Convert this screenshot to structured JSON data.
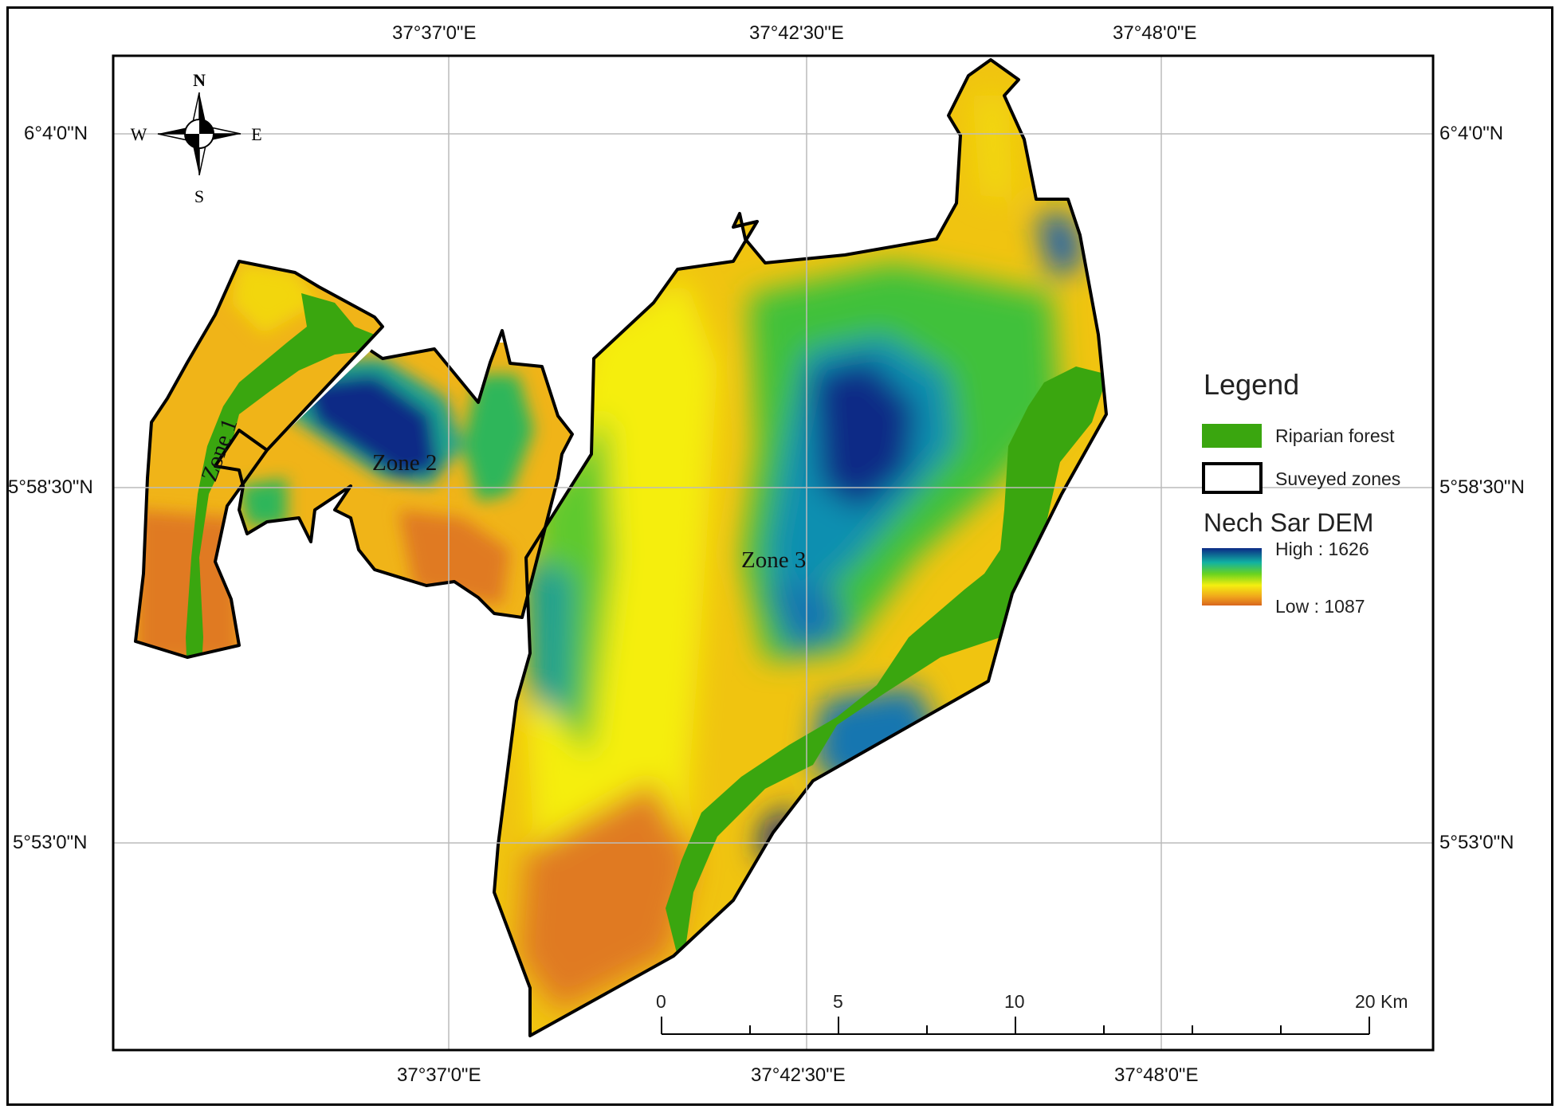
{
  "top_ticks": [
    "37°37'0\"E",
    "37°42'30\"E",
    "37°48'0\"E"
  ],
  "bottom_ticks": [
    "37°37'0\"E",
    "37°42'30\"E",
    "37°48'0\"E"
  ],
  "left_ticks": [
    "6°4'0\"N",
    "5°58'30\"N",
    "5°53'0\"N"
  ],
  "right_ticks": [
    "6°4'0\"N",
    "5°58'30\"N",
    "5°53'0\"N"
  ],
  "compass": {
    "n": "N",
    "s": "S",
    "e": "E",
    "w": "W"
  },
  "zones": [
    "Zone 1",
    "Zone 2",
    "Zone 3"
  ],
  "legend": {
    "title": "Legend",
    "riparian": "Riparian forest",
    "surveyed": "Suveyed zones",
    "dem_title": "Nech Sar DEM",
    "high": "High : 1626",
    "low": "Low : 1087"
  },
  "scale": {
    "labels": [
      "0",
      "5",
      "10",
      "20 Km"
    ]
  },
  "colors": {
    "riparian": "#3aa60f",
    "dem_high": "#0b2a86",
    "dem_mid": "#f5ee10",
    "dem_low": "#d9661e",
    "boundary": "#000000"
  }
}
